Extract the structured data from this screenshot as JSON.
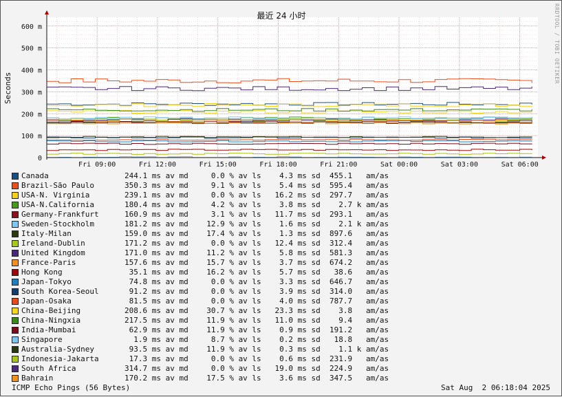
{
  "chart_data": {
    "type": "line",
    "title": "最近 24 小时",
    "ylabel": "Seconds",
    "ylim": [
      0,
      0.64
    ],
    "yticks": [
      {
        "v": 0,
        "label": "0"
      },
      {
        "v": 0.1,
        "label": "100 m"
      },
      {
        "v": 0.2,
        "label": "200 m"
      },
      {
        "v": 0.3,
        "label": "300 m"
      },
      {
        "v": 0.4,
        "label": "400 m"
      },
      {
        "v": 0.5,
        "label": "500 m"
      },
      {
        "v": 0.6,
        "label": "600 m"
      }
    ],
    "xlim": [
      0,
      24.4
    ],
    "xticks": [
      {
        "v": 2.5,
        "label": "Fri 09:00"
      },
      {
        "v": 5.5,
        "label": "Fri 12:00"
      },
      {
        "v": 8.5,
        "label": "Fri 15:00"
      },
      {
        "v": 11.5,
        "label": "Fri 18:00"
      },
      {
        "v": 14.5,
        "label": "Fri 21:00"
      },
      {
        "v": 17.5,
        "label": "Sat 00:00"
      },
      {
        "v": 20.5,
        "label": "Sat 03:00"
      },
      {
        "v": 23.5,
        "label": "Sat 06:00"
      }
    ],
    "grid": true,
    "legend_position": "bottom",
    "series": [
      {
        "name": "Canada",
        "color": "#1b4f7f",
        "avg": 0.2441,
        "stats": "244.1 ms av md     0.0 % av ls    4.3 ms sd  455.1   am/as"
      },
      {
        "name": "Brazil-São Paulo",
        "color": "#e8501c",
        "avg": 0.3503,
        "stats": "350.3 ms av md     9.1 % av ls    5.4 ms sd  595.4   am/as"
      },
      {
        "name": "USA-N. Virginia",
        "color": "#f5d21a",
        "avg": 0.2391,
        "stats": "239.1 ms av md     0.0 % av ls   16.2 ms sd  297.7   am/as"
      },
      {
        "name": "USA-N.California",
        "color": "#4a9a1a",
        "avg": 0.1804,
        "stats": "180.4 ms av md     4.2 % av ls    3.8 ms sd    2.7 k am/as"
      },
      {
        "name": "Germany-Frankfurt",
        "color": "#8a1020",
        "avg": 0.1609,
        "stats": "160.9 ms av md     3.1 % av ls   11.7 ms sd  293.1   am/as"
      },
      {
        "name": "Sweden-Stockholm",
        "color": "#7ec8f2",
        "avg": 0.1812,
        "stats": "181.2 ms av md    12.9 % av ls    1.6 ms sd    2.1 k am/as"
      },
      {
        "name": "Italy-Milan",
        "color": "#2c3a12",
        "avg": 0.159,
        "stats": "159.0 ms av md    17.4 % av ls    1.3 ms sd  897.6   am/as"
      },
      {
        "name": "Ireland-Dublin",
        "color": "#a8c81a",
        "avg": 0.1712,
        "stats": "171.2 ms av md     0.0 % av ls   12.4 ms sd  312.4   am/as"
      },
      {
        "name": "United Kingdom",
        "color": "#4a2878",
        "avg": 0.171,
        "stats": "171.0 ms av md    11.2 % av ls    5.8 ms sd  581.3   am/as"
      },
      {
        "name": "France-Paris",
        "color": "#f29020",
        "avg": 0.1576,
        "stats": "157.6 ms av md    15.7 % av ls    3.7 ms sd  674.2   am/as"
      },
      {
        "name": "Hong Kong",
        "color": "#9a0a0a",
        "avg": 0.0351,
        "stats": " 35.1 ms av md    16.2 % av ls    5.7 ms sd   38.6   am/as"
      },
      {
        "name": "Japan-Tokyo",
        "color": "#1f7fbf",
        "avg": 0.0748,
        "stats": " 74.8 ms av md     0.0 % av ls    3.3 ms sd  646.7   am/as"
      },
      {
        "name": "South Korea-Seoul",
        "color": "#153e6e",
        "avg": 0.0912,
        "stats": " 91.2 ms av md     0.0 % av ls    3.9 ms sd  314.0   am/as"
      },
      {
        "name": "Japan-Osaka",
        "color": "#e84a1a",
        "avg": 0.0815,
        "stats": " 81.5 ms av md     0.0 % av ls    4.0 ms sd  787.7   am/as"
      },
      {
        "name": "China-Beijing",
        "color": "#f5d81a",
        "avg": 0.2086,
        "stats": "208.6 ms av md    30.7 % av ls   23.3 ms sd    3.8   am/as"
      },
      {
        "name": "China-Ningxia",
        "color": "#3a8a1a",
        "avg": 0.2175,
        "stats": "217.5 ms av md    11.9 % av ls   11.0 ms sd    9.4   am/as"
      },
      {
        "name": "India-Mumbai",
        "color": "#7a0a1a",
        "avg": 0.0629,
        "stats": " 62.9 ms av md    11.9 % av ls    0.9 ms sd  191.2   am/as"
      },
      {
        "name": "Singapore",
        "color": "#7ec4f0",
        "avg": 0.0019,
        "stats": "  1.9 ms av md     8.7 % av ls    0.2 ms sd   18.8   am/as"
      },
      {
        "name": "Australia-Sydney",
        "color": "#2a3a10",
        "avg": 0.0935,
        "stats": " 93.5 ms av md    11.9 % av ls    0.3 ms sd    1.1 k am/as"
      },
      {
        "name": "Indonesia-Jakarta",
        "color": "#a8c418",
        "avg": 0.0173,
        "stats": " 17.3 ms av md     0.0 % av ls    0.6 ms sd  231.9   am/as"
      },
      {
        "name": "South Africa",
        "color": "#4a2a7a",
        "avg": 0.3147,
        "stats": "314.7 ms av md     0.0 % av ls   19.0 ms sd  224.9   am/as"
      },
      {
        "name": "Bahrain",
        "color": "#f2941a",
        "avg": 0.1702,
        "stats": "170.2 ms av md    17.5 % av ls    3.6 ms sd  347.5   am/as"
      }
    ]
  },
  "side_label": "RRDTOOL / TOBI OETIKER",
  "footer": {
    "probe": "ICMP Echo Pings (56 Bytes)",
    "timestamp": "Sat Aug  2 06:18:04 2025"
  }
}
